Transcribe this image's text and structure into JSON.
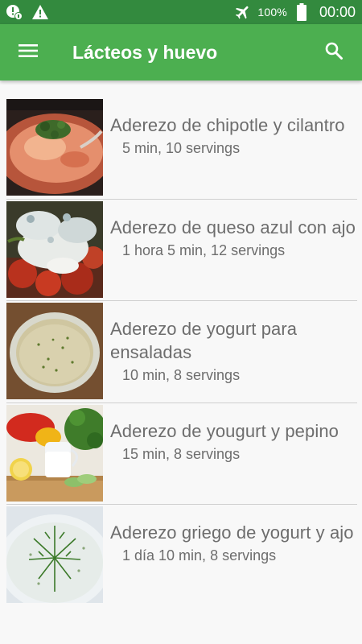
{
  "status_bar": {
    "battery": "100%",
    "time": "00:00",
    "icons": [
      "security-alert-icon",
      "warning-icon",
      "airplane-mode-icon",
      "battery-icon"
    ]
  },
  "app_bar": {
    "title": "Lácteos y huevo",
    "icons": [
      "menu-icon",
      "search-icon"
    ]
  },
  "colors": {
    "status_bar": "#338a3e",
    "app_bar": "#4caf50",
    "text": "#6d6d6d"
  },
  "recipes": [
    {
      "title": "Aderezo de chipotle y cilantro",
      "meta": "5 min, 10 servings",
      "image": "chipotle-cilantro-dressing"
    },
    {
      "title": "Aderezo de queso azul con ajo",
      "meta": "1 hora 5 min, 12 servings",
      "image": "blue-cheese-garlic-dressing"
    },
    {
      "title": "Aderezo de yogurt para ensaladas",
      "meta": "10 min, 8 servings",
      "image": "yogurt-salad-dressing"
    },
    {
      "title": "Aderezo de yougurt y pepino",
      "meta": "15 min, 8 servings",
      "image": "yogurt-cucumber-dressing"
    },
    {
      "title": "Aderezo griego de yogurt y ajo",
      "meta": "1 día 10 min, 8 servings",
      "image": "greek-yogurt-garlic-dressing"
    }
  ]
}
